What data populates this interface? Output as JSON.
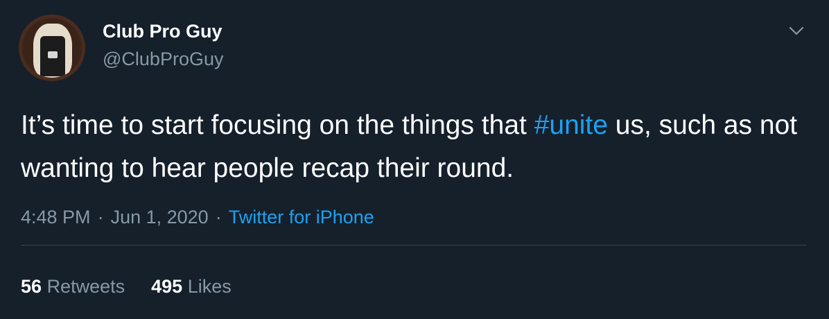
{
  "author": {
    "display_name": "Club Pro Guy",
    "handle": "@ClubProGuy"
  },
  "tweet": {
    "text_before": "It’s time to start focusing on the things that ",
    "hashtag": "#unite",
    "text_after": " us, such as not wanting to hear people recap their round.",
    "time": "4:48 PM",
    "date": "Jun 1, 2020",
    "separator": "·",
    "source": "Twitter for iPhone"
  },
  "stats": {
    "retweets_count": "56",
    "retweets_label": "Retweets",
    "likes_count": "495",
    "likes_label": "Likes"
  },
  "icons": {
    "menu": "chevron-down-icon"
  },
  "colors": {
    "background": "#15202b",
    "accent": "#1da1f2",
    "muted": "#8899a6"
  }
}
